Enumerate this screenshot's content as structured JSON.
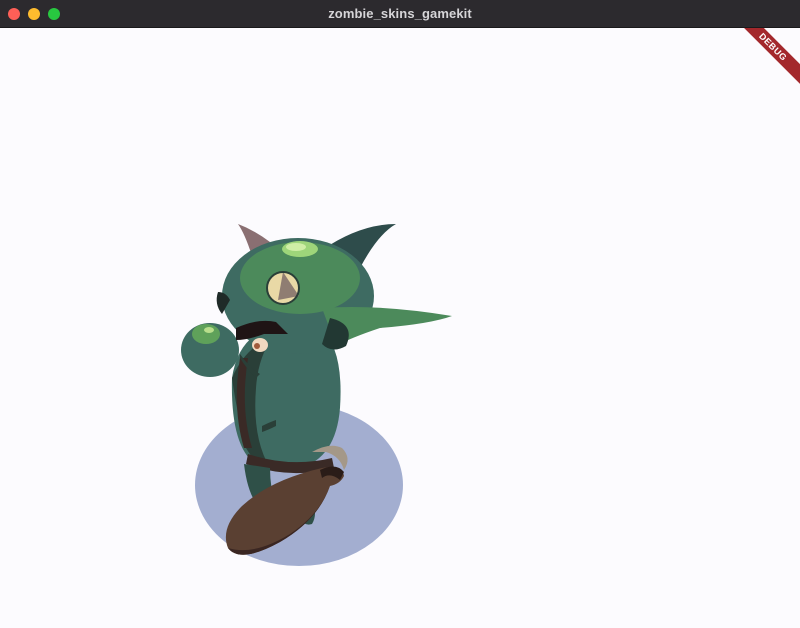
{
  "window": {
    "title": "zombie_skins_gamekit"
  },
  "banner": {
    "label": "DEBUG"
  },
  "scene": {
    "character": "goblin-zombie",
    "weapon": "wooden-club",
    "colors": {
      "background": "#fcfbfe",
      "shadow": "#a3aed0",
      "skin": "#3e6b62",
      "skin_highlight": "#5fa15a",
      "horn": "#8a6f72",
      "club": "#5a4032",
      "banner": "#a3282c"
    }
  }
}
